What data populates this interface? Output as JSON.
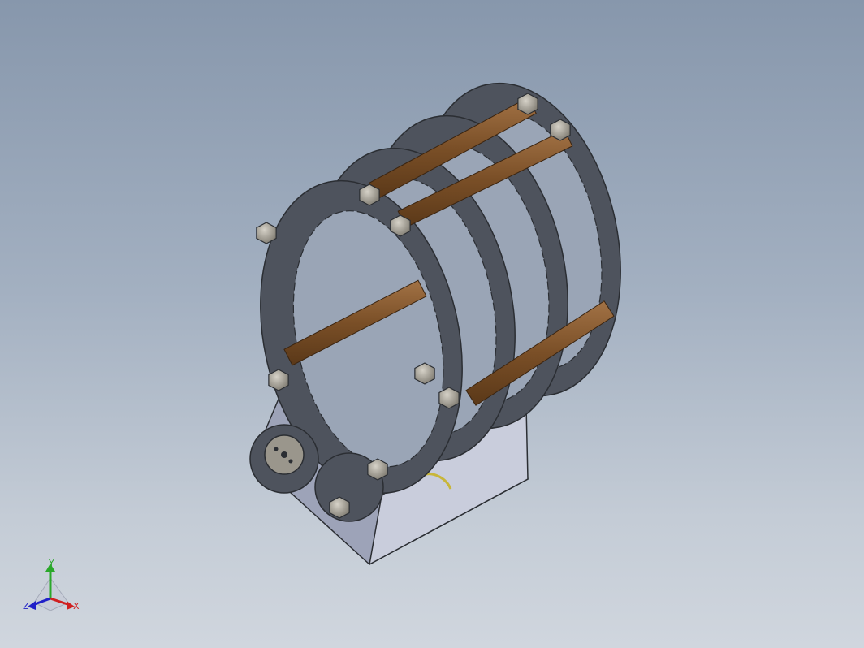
{
  "viewport": {
    "background_top": "#8797ac",
    "background_bottom": "#d0d6de"
  },
  "model": {
    "ring_color": "#4e535d",
    "ring_edge": "#2b2e33",
    "rod_color": "#7a4f27",
    "rod_light": "#a27245",
    "bolt_color": "#9a968c",
    "bracket_color": "#b8bdd2",
    "servo_color": "#303364"
  },
  "triad": {
    "y_label": "Y",
    "x_label": "X",
    "z_label": "Z",
    "y_color": "#2aa82a",
    "x_color": "#d02020",
    "z_color": "#2020c8"
  }
}
